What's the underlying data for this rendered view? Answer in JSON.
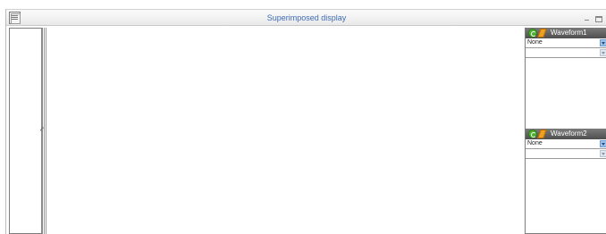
{
  "window": {
    "title": "Superimposed display"
  },
  "icons": {
    "app": "document-icon",
    "minimize": "minimize-icon",
    "maximize": "maximize-icon",
    "close": "close-icon",
    "splitter": "resize-handle-icon",
    "refresh": "refresh-icon",
    "tool": "pencil-icon"
  },
  "waveform_panels": [
    {
      "title": "Waveform1",
      "selection": "None",
      "second_selection": ""
    },
    {
      "title": "Waveform2",
      "selection": "None",
      "second_selection": ""
    }
  ],
  "colors": {
    "title_text": "#3f6cb3",
    "panel_header": "#5a5a5a",
    "dropdown_accent": "#9ec3ea"
  }
}
